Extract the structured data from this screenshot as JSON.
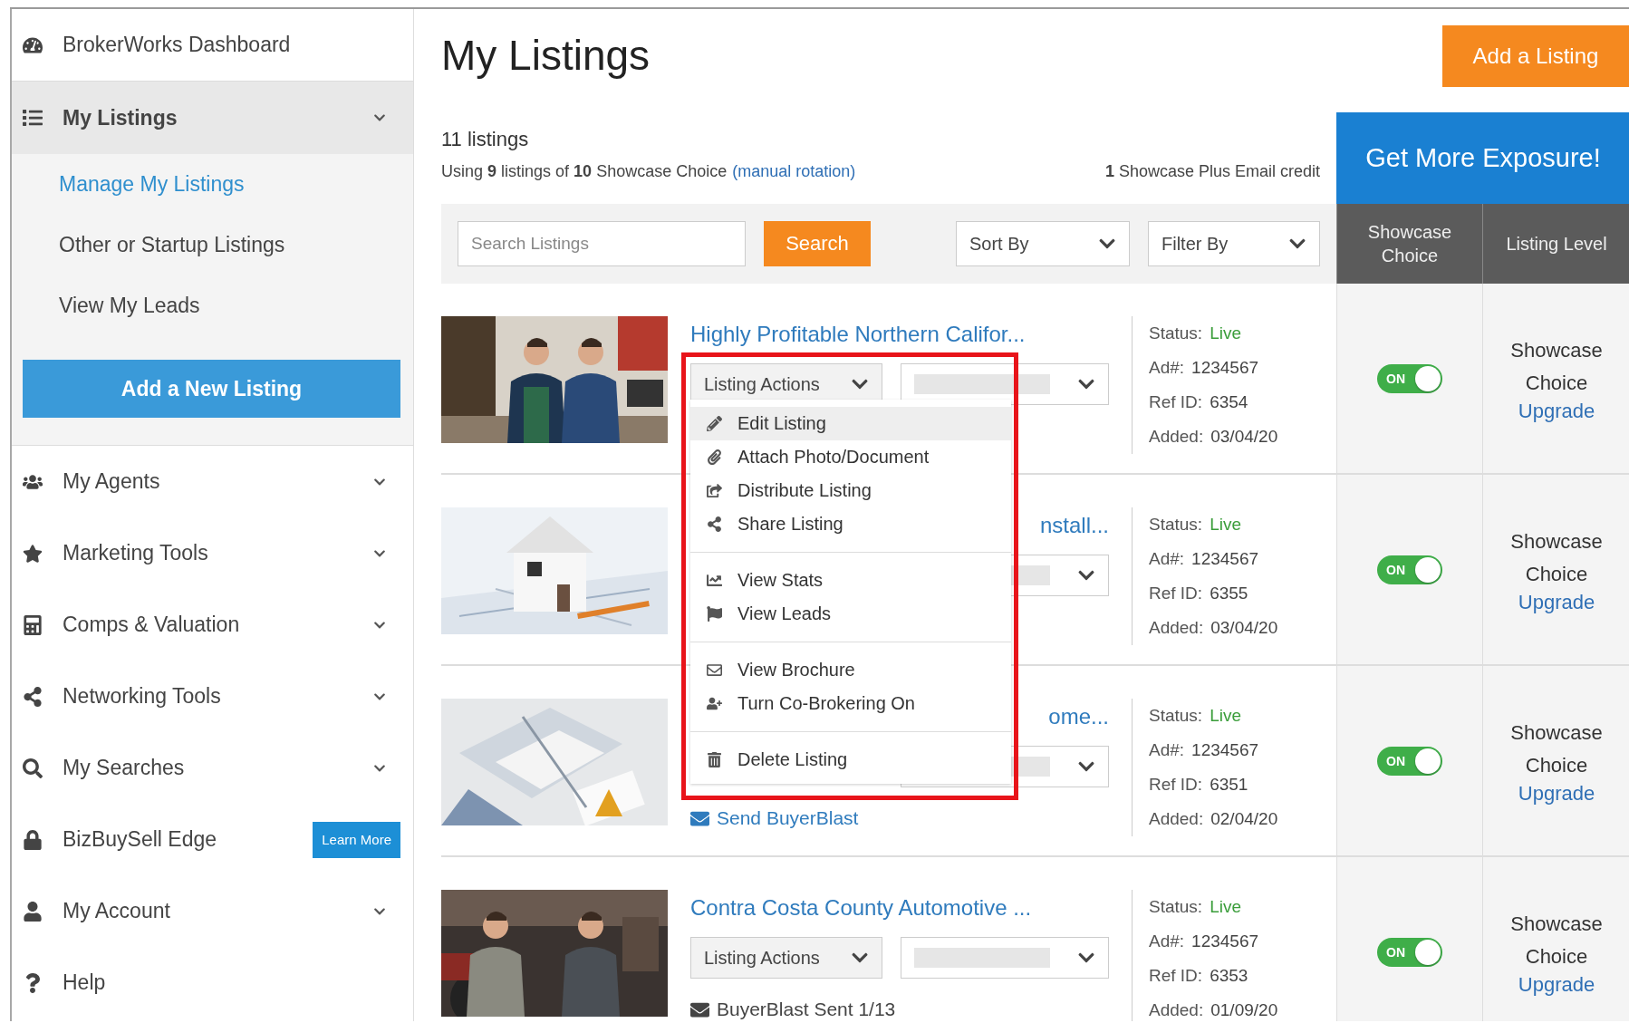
{
  "sidebar": {
    "items": [
      {
        "kind": "link",
        "label": "BrokerWorks Dashboard"
      },
      {
        "kind": "group",
        "label": "My Listings",
        "expanded": true,
        "children": [
          {
            "label": "Manage My Listings",
            "selected": true
          },
          {
            "label": "Other or Startup Listings",
            "selected": false
          },
          {
            "label": "View My Leads",
            "selected": false
          }
        ],
        "button": "Add a New Listing"
      },
      {
        "kind": "group",
        "label": "My Agents",
        "expanded": false
      },
      {
        "kind": "group",
        "label": "Marketing Tools",
        "expanded": false
      },
      {
        "kind": "group",
        "label": "Comps & Valuation",
        "expanded": false
      },
      {
        "kind": "group",
        "label": "Networking Tools",
        "expanded": false
      },
      {
        "kind": "group",
        "label": "My Searches",
        "expanded": false
      },
      {
        "kind": "promo",
        "label": "BizBuySell Edge",
        "badge": "Learn More"
      },
      {
        "kind": "group",
        "label": "My Account",
        "expanded": false
      },
      {
        "kind": "link",
        "label": "Help"
      }
    ]
  },
  "page": {
    "title": "My Listings",
    "add_button": "Add a Listing"
  },
  "summary": {
    "count": "11 listings",
    "usage": "Using **9** listings of **10** Showcase Choice",
    "rotation_link": "(manual rotation)",
    "credit": "**1** Showcase Plus Email credit"
  },
  "promo_banner": "Get More Exposure!",
  "toolbar": {
    "search_placeholder": "Search Listings",
    "search_button": "Search",
    "sort": "Sort By",
    "filter": "Filter By"
  },
  "columns": [
    "Showcase Choice",
    "Listing Level"
  ],
  "listings": [
    {
      "title": "Highly Profitable Northern Califor...",
      "covered": false,
      "actions": "Listing Actions",
      "fields": [
        {
          "kind": "status",
          "label": "Status:",
          "value": "Live"
        },
        {
          "kind": "plain",
          "label": "Ad#:",
          "value": "1234567"
        },
        {
          "kind": "plain",
          "label": "Ref ID:",
          "value": "6354"
        },
        {
          "kind": "plain",
          "label": "Added:",
          "value": "03/04/20"
        }
      ],
      "toggle": "ON",
      "on": true,
      "level": "Showcase Choice",
      "upgrade": "Upgrade"
    },
    {
      "title": "nstall...",
      "covered": true,
      "fields": [
        {
          "kind": "status",
          "label": "Status:",
          "value": "Live"
        },
        {
          "kind": "plain",
          "label": "Ad#:",
          "value": "1234567"
        },
        {
          "kind": "plain",
          "label": "Ref ID:",
          "value": "6355"
        },
        {
          "kind": "plain",
          "label": "Added:",
          "value": "03/04/20"
        }
      ],
      "toggle": "ON",
      "on": true,
      "level": "Showcase Choice",
      "upgrade": "Upgrade"
    },
    {
      "title": "ome...",
      "covered": true,
      "footer": {
        "kind": "link",
        "text": "Send BuyerBlast"
      },
      "fields": [
        {
          "kind": "status",
          "label": "Status:",
          "value": "Live"
        },
        {
          "kind": "plain",
          "label": "Ad#:",
          "value": "1234567"
        },
        {
          "kind": "plain",
          "label": "Ref ID:",
          "value": "6351"
        },
        {
          "kind": "plain",
          "label": "Added:",
          "value": "02/04/20"
        }
      ],
      "toggle": "ON",
      "on": true,
      "level": "Showcase Choice",
      "upgrade": "Upgrade"
    },
    {
      "title": "Contra Costa County Automotive ...",
      "covered": false,
      "actions": "Listing Actions",
      "footer": {
        "kind": "note",
        "text": "BuyerBlast Sent 1/13"
      },
      "fields": [
        {
          "kind": "status",
          "label": "Status:",
          "value": "Live"
        },
        {
          "kind": "plain",
          "label": "Ad#:",
          "value": "1234567"
        },
        {
          "kind": "plain",
          "label": "Ref ID:",
          "value": "6353"
        },
        {
          "kind": "plain",
          "label": "Added:",
          "value": "01/09/20"
        }
      ],
      "toggle": "ON",
      "on": true,
      "level": "Showcase Choice",
      "upgrade": "Upgrade"
    }
  ],
  "action_menu": {
    "groups": [
      {
        "items": [
          {
            "label": "Edit Listing",
            "selected": true
          },
          {
            "label": "Attach Photo/Document",
            "selected": false
          },
          {
            "label": "Distribute Listing",
            "selected": false
          },
          {
            "label": "Share Listing",
            "selected": false
          }
        ]
      },
      {
        "items": [
          {
            "label": "View Stats",
            "selected": false
          },
          {
            "label": "View Leads",
            "selected": false
          }
        ]
      },
      {
        "items": [
          {
            "label": "View Brochure",
            "selected": false
          },
          {
            "label": "Turn Co-Brokering On",
            "selected": false
          }
        ]
      },
      {
        "items": [
          {
            "label": "Delete Listing",
            "selected": false
          }
        ]
      }
    ]
  }
}
